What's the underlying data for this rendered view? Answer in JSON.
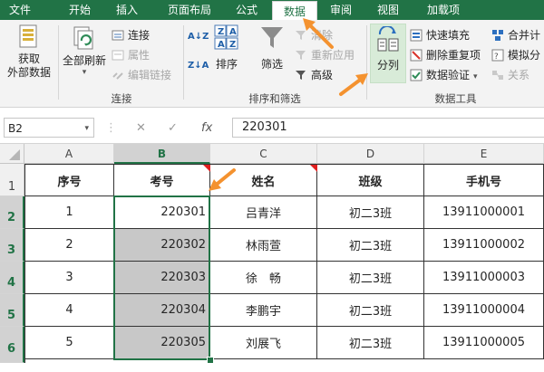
{
  "tabs": [
    "文件",
    "开始",
    "插入",
    "页面布局",
    "公式",
    "数据",
    "审阅",
    "视图",
    "加载项"
  ],
  "active_tab": "数据",
  "ribbon": {
    "get_external_data": "获取\n外部数据",
    "refresh_all": "全部刷新",
    "connections": "连接",
    "properties": "属性",
    "edit_links": "编辑链接",
    "group_connections": "连接",
    "sort_az": "A↓Z",
    "sort_za": "Z↓A",
    "sort": "排序",
    "filter": "筛选",
    "clear": "清除",
    "reapply": "重新应用",
    "advanced": "高级",
    "group_sort_filter": "排序和筛选",
    "text_to_columns": "分列",
    "flash_fill": "快速填充",
    "remove_duplicates": "删除重复项",
    "data_validation": "数据验证",
    "consolidate": "合并计",
    "what_if": "模拟分",
    "relationships": "关系",
    "group_data_tools": "数据工具"
  },
  "formula_bar": {
    "name_box": "B2",
    "cancel": "✕",
    "enter": "✓",
    "fx": "fx",
    "value": "220301"
  },
  "columns": [
    "A",
    "B",
    "C",
    "D",
    "E"
  ],
  "selected_column": "B",
  "rows": [
    "1",
    "2",
    "3",
    "4",
    "5",
    "6"
  ],
  "headers": [
    "序号",
    "考号",
    "姓名",
    "班级",
    "手机号"
  ],
  "data": [
    [
      "1",
      "220301",
      "吕青洋",
      "初二3班",
      "13911000001"
    ],
    [
      "2",
      "220302",
      "林雨萱",
      "初二3班",
      "13911000002"
    ],
    [
      "3",
      "220303",
      "徐　畅",
      "初二3班",
      "13911000003"
    ],
    [
      "4",
      "220304",
      "李鹏宇",
      "初二3班",
      "13911000004"
    ],
    [
      "5",
      "220305",
      "刘展飞",
      "初二3班",
      "13911000005"
    ]
  ],
  "colors": {
    "ribbon_green": "#217346",
    "annotation_orange": "#f4922f",
    "selected_range_fill": "#c8c8c8"
  }
}
